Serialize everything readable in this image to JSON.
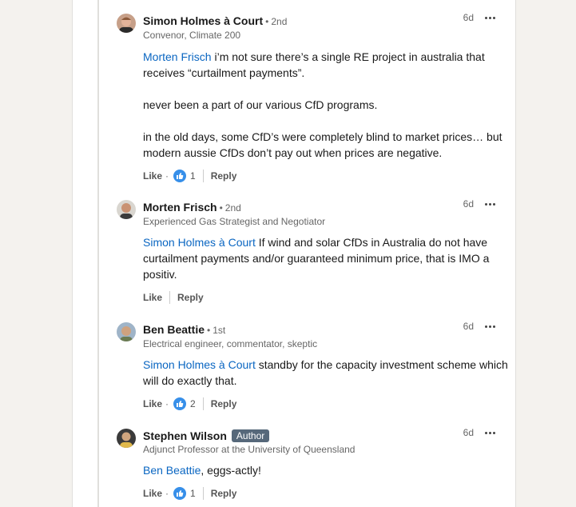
{
  "comments": [
    {
      "author": "Simon Holmes à Court",
      "degree": "2nd",
      "headline": "Convenor, Climate 200",
      "time": "6d",
      "mention": "Morten Frisch",
      "text_1": " i’m not sure there’s a single RE project in australia that receives “curtailment payments”.",
      "text_2": "never been a part of our various CfD programs.",
      "text_3": "in the old days, some CfD’s were completely blind to market prices… but modern aussie CfDs don’t pay out when prices are negative.",
      "like_label": "Like",
      "reactions": "1",
      "reply_label": "Reply"
    },
    {
      "author": "Morten Frisch",
      "degree": "2nd",
      "headline": "Experienced Gas Strategist and Negotiator",
      "time": "6d",
      "mention": "Simon Holmes à Court",
      "text_1": " If wind and solar CfDs in Australia do not have curtailment payments and/or guaranteed minimum price, that is IMO a positiv.",
      "like_label": "Like",
      "reply_label": "Reply"
    },
    {
      "author": "Ben Beattie",
      "degree": "1st",
      "headline": "Electrical engineer, commentator, skeptic",
      "time": "6d",
      "mention": "Simon Holmes à Court",
      "text_1": " standby for the capacity investment scheme which will do exactly that.",
      "like_label": "Like",
      "reactions": "2",
      "reply_label": "Reply"
    },
    {
      "author": "Stephen Wilson",
      "badge": "Author",
      "headline": "Adjunct Professor at the University of Queensland",
      "time": "6d",
      "mention": "Ben Beattie",
      "text_1": ", eggs-actly!",
      "like_label": "Like",
      "reactions": "1",
      "reply_label": "Reply"
    }
  ],
  "colors": {
    "mention": "#0a66c2",
    "like": "#378fe9",
    "badge": "#56687a"
  },
  "icons": {
    "more": "more-horizontal-icon",
    "like": "like-reaction-icon"
  }
}
